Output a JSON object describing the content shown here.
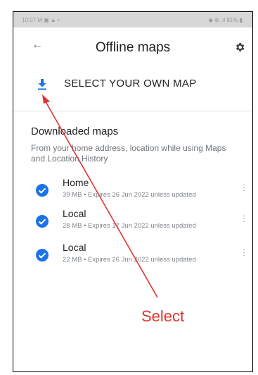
{
  "status_bar": {
    "left": "10:07 M ▣ ▲ •",
    "right": "◆ ⊕ .ıl 81% ▮"
  },
  "header": {
    "title": "Offline maps",
    "back_icon": "arrow-back-icon",
    "settings_icon": "gear-icon"
  },
  "select_own_map": {
    "label": "SELECT YOUR OWN MAP",
    "icon": "download-icon"
  },
  "downloaded": {
    "title": "Downloaded maps",
    "description": "From your home address, location while using Maps and Location History",
    "items": [
      {
        "name": "Home",
        "meta": "39 MB • Expires 26 Jun 2022 unless updated"
      },
      {
        "name": "Local",
        "meta": "28 MB • Expires 17 Jun 2022 unless updated"
      },
      {
        "name": "Local",
        "meta": "22 MB • Expires 26 Jun 2022 unless updated"
      }
    ]
  },
  "annotation": {
    "text": "Select",
    "color": "#e0332f"
  },
  "colors": {
    "accent": "#1a73e8",
    "text": "#202124",
    "secondary": "#70757a"
  }
}
